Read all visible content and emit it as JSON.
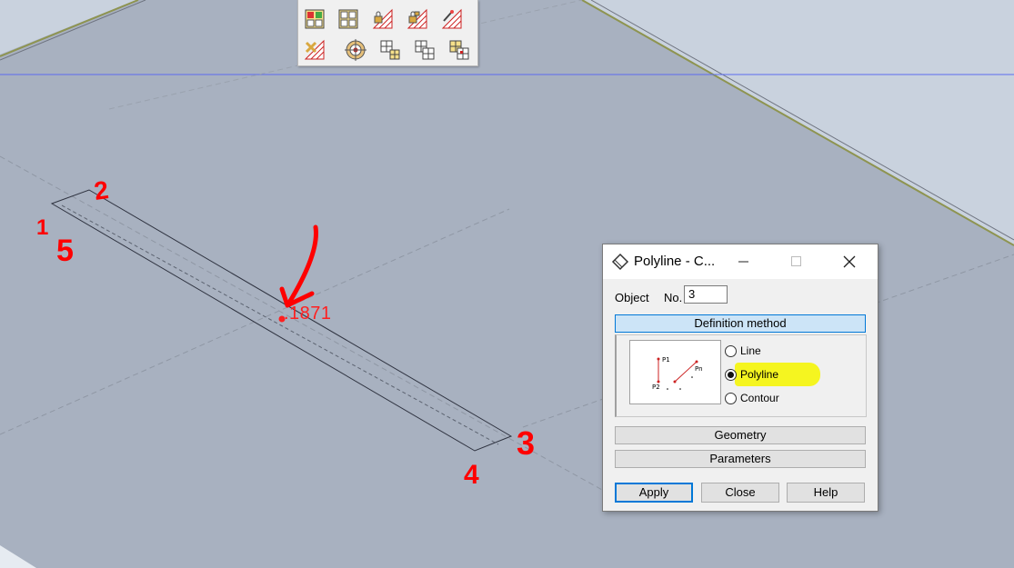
{
  "toolbar": {
    "icons": [
      "selection-grid-icon",
      "grid-frame-icon",
      "lock-grid-icon",
      "lock-unlock-grid-icon",
      "magic-wand-grid-icon",
      "delete-grid-icon",
      "target-crosshair-icon",
      "grid-move-icon",
      "grid-copy-icon",
      "grid-paste-icon"
    ]
  },
  "viewport": {
    "node_label": ".1871",
    "annotations": [
      "2",
      "1",
      "5",
      "3",
      "4"
    ],
    "colors": {
      "background": "#a8b1c0",
      "plate_edge": "#9aa35a",
      "annotation": "#ff0000",
      "axis_line": "#5b6cf0"
    }
  },
  "dialog": {
    "title": "Polyline - C...",
    "object_label": "Object",
    "no_label": "No.",
    "no_value": "3",
    "definition_method_label": "Definition method",
    "preview": {
      "p1": "P1",
      "p2": "P2",
      "pn": "Pn"
    },
    "options": [
      {
        "label": "Line",
        "checked": false
      },
      {
        "label": "Polyline",
        "checked": true
      },
      {
        "label": "Contour",
        "checked": false
      }
    ],
    "geometry_label": "Geometry",
    "parameters_label": "Parameters",
    "apply_label": "Apply",
    "close_label": "Close",
    "help_label": "Help",
    "highlight_color": "#f5f520"
  }
}
